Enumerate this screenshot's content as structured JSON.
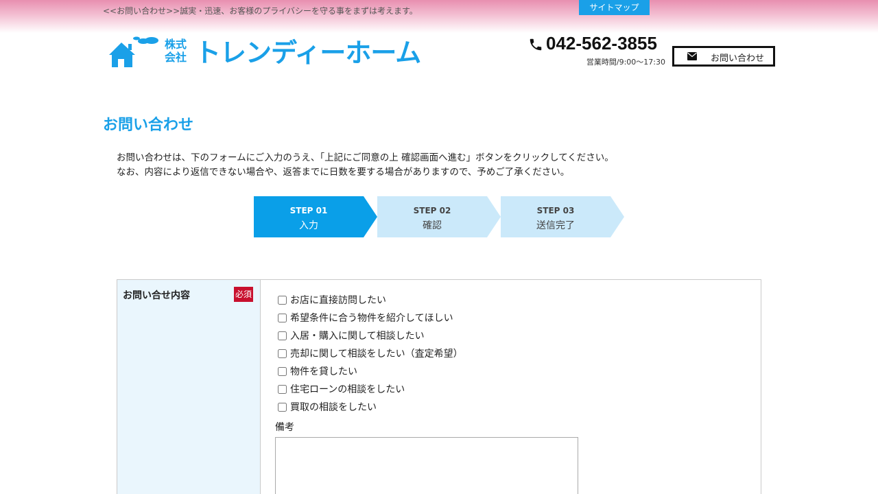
{
  "header": {
    "tagline": "<<お問い合わせ>>誠実・迅速、お客様のプライバシーを守る事をまずは考えます。",
    "sitemap_label": "サイトマップ",
    "logo": {
      "company_type": "株式\n会社",
      "name": "トレンディーホーム"
    },
    "phone": "042-562-3855",
    "hours": "営業時間/9:00～17:30",
    "contact_button_label": "お問い合わせ"
  },
  "page": {
    "title": "お問い合わせ",
    "intro_line1": "お問い合わせは、下のフォームにご入力のうえ、「上記にご同意の上 確認画面へ進む」ボタンをクリックしてください。",
    "intro_line2": "なお、内容により返信できない場合や、返答までに日数を要する場合がありますので、予めご了承ください。"
  },
  "steps": [
    {
      "number": "STEP 01",
      "label": "入力",
      "active": true
    },
    {
      "number": "STEP 02",
      "label": "確認",
      "active": false
    },
    {
      "number": "STEP 03",
      "label": "送信完了",
      "active": false
    }
  ],
  "form": {
    "inquiry_label": "お問い合せ内容",
    "required_badge": "必須",
    "options": [
      "お店に直接訪問したい",
      "希望条件に合う物件を紹介してほしい",
      "入居・購入に関して相談したい",
      "売却に関して相談をしたい（査定希望）",
      "物件を貸したい",
      "住宅ローンの相談をしたい",
      "買取の相談をしたい"
    ],
    "remarks_label": "備考",
    "remarks_value": ""
  },
  "colors": {
    "brand_blue": "#1aa0e8",
    "step_inactive": "#cbe9fa",
    "required_red": "#c8102e",
    "label_bg": "#eaf6fd"
  }
}
